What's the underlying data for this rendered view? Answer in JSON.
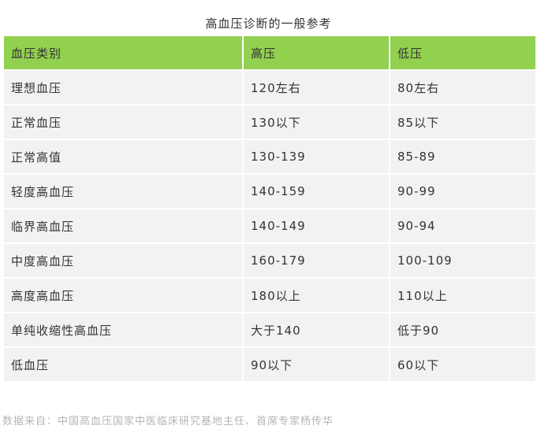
{
  "title": "高血压诊断的一般参考",
  "table": {
    "headers": [
      "血压类别",
      "高压",
      "低压"
    ],
    "rows": [
      [
        "理想血压",
        "120左右",
        "80左右"
      ],
      [
        "正常血压",
        "130以下",
        "85以下"
      ],
      [
        "正常高值",
        "130-139",
        "85-89"
      ],
      [
        "轻度高血压",
        "140-159",
        "90-99"
      ],
      [
        "临界高血压",
        "140-149",
        "90-94"
      ],
      [
        "中度高血压",
        "160-179",
        "100-109"
      ],
      [
        "高度高血压",
        "180以上",
        "110以上"
      ],
      [
        "单纯收缩性高血压",
        "大于140",
        "低于90"
      ],
      [
        "低血压",
        "90以下",
        "60以下"
      ]
    ]
  },
  "source": "数据来自：中国高血压国家中医临床研究基地主任、首席专家杨传华",
  "colors": {
    "header_bg": "#92d050",
    "row_bg": "#f2f2f2",
    "text": "#333333",
    "source_text": "#b5b5b5"
  }
}
